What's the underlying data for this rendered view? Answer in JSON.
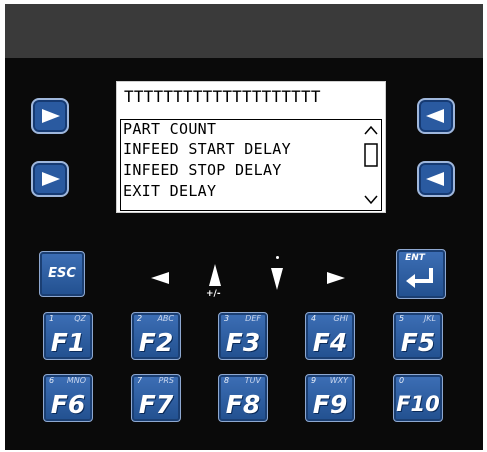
{
  "display": {
    "title": "TTTTTTTTTTTTTTTTTTTT",
    "menu_items": [
      "PART COUNT",
      "INFEED START DELAY",
      "INFEED STOP DELAY",
      "EXIT DELAY"
    ]
  },
  "nav_keys": {
    "esc_label": "ESC",
    "enter_label": "ENT",
    "up_caption": "+/-"
  },
  "function_keys": [
    {
      "num": "1",
      "alpha": "QZ",
      "label": "F1"
    },
    {
      "num": "2",
      "alpha": "ABC",
      "label": "F2"
    },
    {
      "num": "3",
      "alpha": "DEF",
      "label": "F3"
    },
    {
      "num": "4",
      "alpha": "GHI",
      "label": "F4"
    },
    {
      "num": "5",
      "alpha": "JKL",
      "label": "F5"
    },
    {
      "num": "6",
      "alpha": "MNO",
      "label": "F6"
    },
    {
      "num": "7",
      "alpha": "PRS",
      "label": "F7"
    },
    {
      "num": "8",
      "alpha": "TUV",
      "label": "F8"
    },
    {
      "num": "9",
      "alpha": "WXY",
      "label": "F9"
    },
    {
      "num": "0",
      "alpha": "",
      "label": "F10"
    }
  ],
  "colors": {
    "key_blue": "#2a5aa0",
    "panel": "#0a0a0a",
    "bezel": "#3a3a3a"
  },
  "icons": [
    "arrow-right-icon",
    "arrow-left-icon",
    "arrow-up-icon",
    "arrow-down-icon",
    "scroll-up-icon",
    "scroll-down-icon",
    "enter-icon"
  ]
}
